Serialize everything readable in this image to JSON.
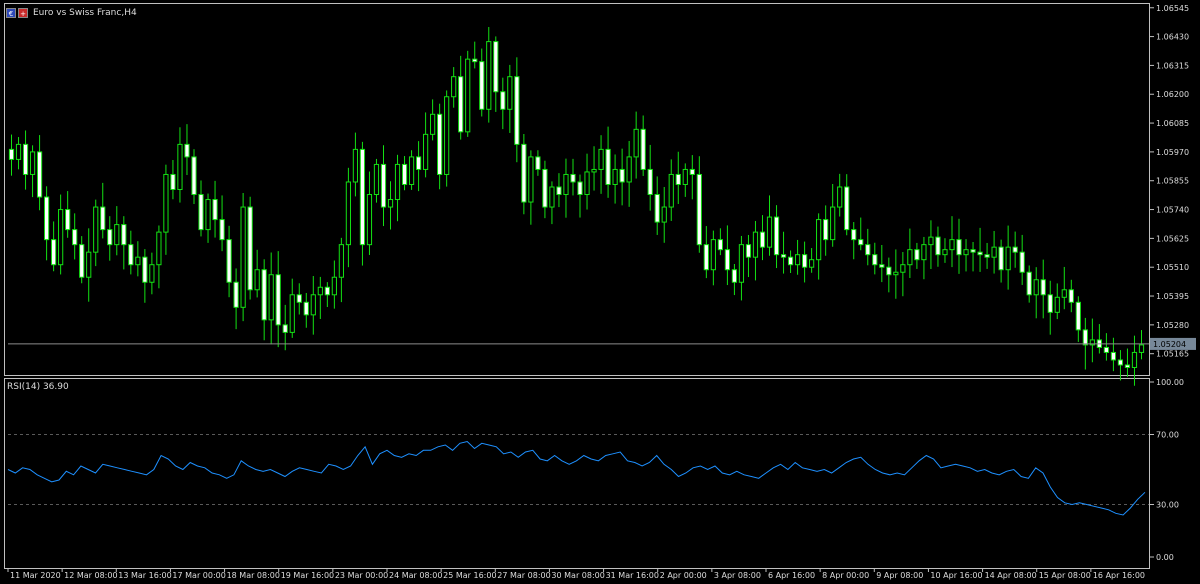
{
  "symbol_title": "Euro vs Swiss Franc,H4",
  "icons": {
    "left": "euro-flag-icon",
    "right": "swiss-flag-icon"
  },
  "colors": {
    "background": "#000000",
    "frame": "#c0c0c0",
    "grid": "#5a5a5a",
    "candle": "#13e113",
    "candle_body_bull": "#000000",
    "candle_body_bear": "#ffffff",
    "rsi_line": "#1e90ff",
    "price_line": "#8c8c8c",
    "text": "#dddddd",
    "price_label_bg": "#778899"
  },
  "chart_data": [
    {
      "type": "candlestick",
      "title": "Euro vs Swiss Franc,H4",
      "ylim": [
        1.0508,
        1.0656
      ],
      "y_ticks": [
        "1.06545",
        "1.06430",
        "1.06315",
        "1.06200",
        "1.06085",
        "1.05970",
        "1.05855",
        "1.05740",
        "1.05625",
        "1.05510",
        "1.05395",
        "1.05280",
        "1.05165"
      ],
      "current_price": "1.05204",
      "x_ticks": [
        "11 Mar 2020",
        "12 Mar 08:00",
        "13 Mar 16:00",
        "17 Mar 00:00",
        "18 Mar 08:00",
        "19 Mar 16:00",
        "23 Mar 00:00",
        "24 Mar 08:00",
        "25 Mar 16:00",
        "27 Mar 08:00",
        "30 Mar 08:00",
        "31 Mar 16:00",
        "2 Apr 00:00",
        "3 Apr 08:00",
        "6 Apr 16:00",
        "8 Apr 00:00",
        "9 Apr 08:00",
        "10 Apr 16:00",
        "14 Apr 08:00",
        "15 Apr 08:00",
        "16 Apr 16:00"
      ],
      "closes": [
        1.0594,
        1.06,
        1.0588,
        1.0597,
        1.0579,
        1.0562,
        1.0552,
        1.0574,
        1.0566,
        1.056,
        1.0547,
        1.0557,
        1.0575,
        1.0566,
        1.056,
        1.0568,
        1.056,
        1.0552,
        1.0555,
        1.0545,
        1.0552,
        1.0565,
        1.0588,
        1.0582,
        1.06,
        1.0595,
        1.058,
        1.0566,
        1.0578,
        1.057,
        1.0562,
        1.0545,
        1.0535,
        1.0575,
        1.0542,
        1.055,
        1.053,
        1.0548,
        1.0528,
        1.0525,
        1.054,
        1.0537,
        1.0532,
        1.054,
        1.0543,
        1.054,
        1.0547,
        1.056,
        1.0585,
        1.0598,
        1.056,
        1.058,
        1.0592,
        1.0575,
        1.0578,
        1.0592,
        1.0584,
        1.0595,
        1.059,
        1.0604,
        1.0612,
        1.0588,
        1.0619,
        1.0627,
        1.0605,
        1.0634,
        1.0633,
        1.0614,
        1.0641,
        1.0621,
        1.0614,
        1.0627,
        1.06,
        1.0577,
        1.0595,
        1.059,
        1.0575,
        1.0583,
        1.058,
        1.0588,
        1.0585,
        1.058,
        1.0589,
        1.059,
        1.0598,
        1.0584,
        1.059,
        1.0585,
        1.0595,
        1.0606,
        1.059,
        1.058,
        1.0569,
        1.0575,
        1.0588,
        1.0584,
        1.059,
        1.0588,
        1.056,
        1.055,
        1.0562,
        1.0558,
        1.055,
        1.0545,
        1.056,
        1.0555,
        1.0565,
        1.0559,
        1.0571,
        1.0556,
        1.0555,
        1.0552,
        1.0556,
        1.0551,
        1.0554,
        1.057,
        1.0562,
        1.0575,
        1.0583,
        1.0566,
        1.0562,
        1.056,
        1.0556,
        1.0552,
        1.0551,
        1.0548,
        1.0549,
        1.0552,
        1.0558,
        1.0554,
        1.056,
        1.0563,
        1.0556,
        1.0558,
        1.0562,
        1.0556,
        1.0558,
        1.0557,
        1.0556,
        1.0555,
        1.0559,
        1.055,
        1.0559,
        1.0557,
        1.0549,
        1.054,
        1.0546,
        1.054,
        1.0533,
        1.0539,
        1.0542,
        1.0537,
        1.0526,
        1.052,
        1.0522,
        1.0519,
        1.0517,
        1.0514,
        1.0512,
        1.0511,
        1.0517,
        1.052
      ]
    },
    {
      "type": "line",
      "indicator": "RSI(14)",
      "label": "RSI(14) 36.90",
      "ylim": [
        0,
        100
      ],
      "y_ticks": [
        "100.00",
        "70.00",
        "30.00",
        "0.00"
      ],
      "levels": [
        70,
        30
      ],
      "values": [
        50,
        48,
        51,
        50,
        47,
        45,
        43,
        44,
        49,
        47,
        52,
        50,
        48,
        53,
        52,
        51,
        50,
        49,
        48,
        47,
        50,
        58,
        56,
        52,
        50,
        54,
        52,
        51,
        48,
        47,
        45,
        47,
        55,
        52,
        50,
        49,
        50,
        48,
        46,
        49,
        51,
        50,
        49,
        48,
        53,
        52,
        50,
        52,
        58,
        63,
        53,
        59,
        61,
        58,
        57,
        59,
        58,
        61,
        61,
        63,
        64,
        61,
        65,
        66,
        62,
        65,
        64,
        63,
        59,
        60,
        57,
        60,
        61,
        56,
        55,
        58,
        55,
        53,
        55,
        58,
        56,
        55,
        58,
        59,
        60,
        55,
        54,
        52,
        54,
        58,
        53,
        50,
        46,
        48,
        51,
        52,
        50,
        52,
        48,
        47,
        49,
        47,
        46,
        45,
        48,
        51,
        53,
        50,
        54,
        51,
        50,
        49,
        50,
        48,
        51,
        54,
        56,
        57,
        53,
        50,
        48,
        47,
        48,
        47,
        51,
        55,
        58,
        56,
        51,
        52,
        53,
        52,
        51,
        49,
        50,
        48,
        47,
        49,
        50,
        46,
        45,
        51,
        48,
        40,
        34,
        31,
        30,
        31,
        30,
        29,
        28,
        27,
        25,
        24,
        28,
        33,
        37
      ]
    }
  ]
}
